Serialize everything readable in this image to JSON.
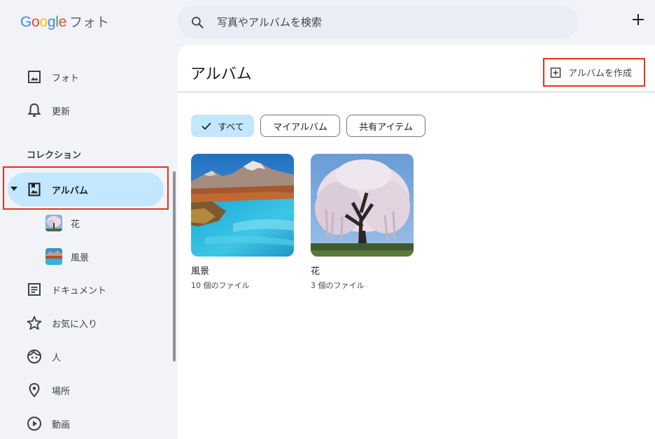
{
  "header": {
    "logo_word": [
      "G",
      "o",
      "o",
      "g",
      "l",
      "e"
    ],
    "app_name": "フォト",
    "search_placeholder": "写真やアルバムを検索"
  },
  "sidebar": {
    "items_top": [
      {
        "label": "フォト",
        "icon": "photo-icon"
      },
      {
        "label": "更新",
        "icon": "bell-icon"
      }
    ],
    "section_title": "コレクション",
    "albums_label": "アルバム",
    "album_children": [
      {
        "label": "花"
      },
      {
        "label": "風景"
      }
    ],
    "items_bottom": [
      {
        "label": "ドキュメント",
        "icon": "document-icon"
      },
      {
        "label": "お気に入り",
        "icon": "star-icon"
      },
      {
        "label": "人",
        "icon": "face-icon"
      },
      {
        "label": "場所",
        "icon": "location-icon"
      },
      {
        "label": "動画",
        "icon": "play-icon"
      }
    ]
  },
  "main": {
    "title": "アルバム",
    "create_label": "アルバムを作成",
    "chips": [
      {
        "label": "すべて",
        "selected": true
      },
      {
        "label": "マイアルバム",
        "selected": false
      },
      {
        "label": "共有アイテム",
        "selected": false
      }
    ],
    "albums": [
      {
        "name": "風景",
        "count": "10 個のファイル"
      },
      {
        "name": "花",
        "count": "3 個のファイル"
      }
    ]
  },
  "colors": {
    "accent": "#c2e7ff",
    "highlight": "#ea2f1a",
    "background": "#f1f3f8"
  }
}
